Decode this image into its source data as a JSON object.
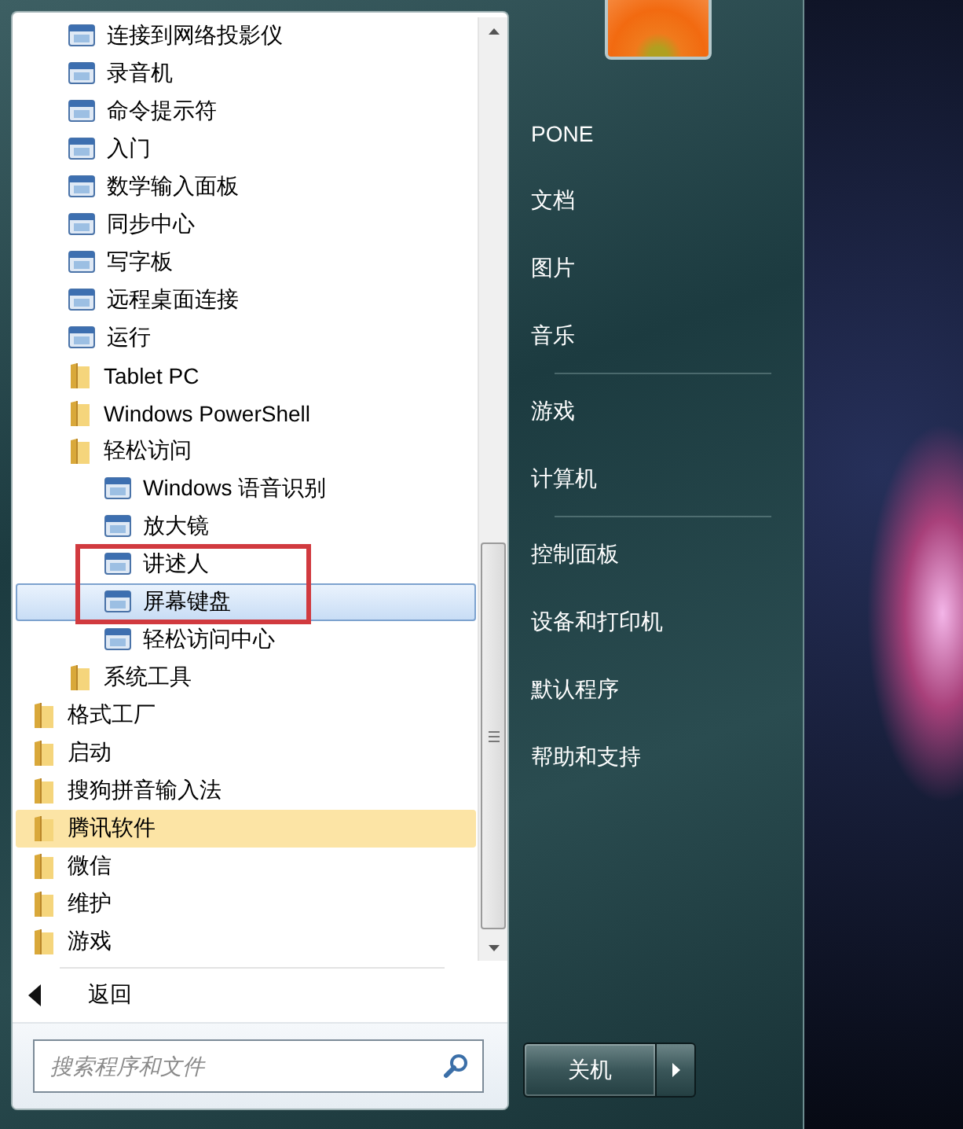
{
  "programs": [
    {
      "kind": "group",
      "children": [
        {
          "kind": "program",
          "label": "连接到网络投影仪",
          "selected": false,
          "new": false,
          "marked": false
        },
        {
          "kind": "program",
          "label": "录音机",
          "selected": false,
          "new": false,
          "marked": false
        },
        {
          "kind": "program",
          "label": "命令提示符",
          "selected": false,
          "new": false,
          "marked": false
        },
        {
          "kind": "program",
          "label": "入门",
          "selected": false,
          "new": false,
          "marked": false
        },
        {
          "kind": "program",
          "label": "数学输入面板",
          "selected": false,
          "new": false,
          "marked": false
        },
        {
          "kind": "program",
          "label": "同步中心",
          "selected": false,
          "new": false,
          "marked": false
        },
        {
          "kind": "program",
          "label": "写字板",
          "selected": false,
          "new": false,
          "marked": false
        },
        {
          "kind": "program",
          "label": "远程桌面连接",
          "selected": false,
          "new": false,
          "marked": false
        },
        {
          "kind": "program",
          "label": "运行",
          "selected": false,
          "new": false,
          "marked": false
        },
        {
          "kind": "folder",
          "label": "Tablet PC",
          "selected": false,
          "new": false,
          "marked": false
        },
        {
          "kind": "folder",
          "label": "Windows PowerShell",
          "selected": false,
          "new": false,
          "marked": false
        },
        {
          "kind": "folder",
          "label": "轻松访问",
          "selected": false,
          "new": false,
          "marked": false,
          "children": [
            {
              "kind": "program",
              "label": "Windows 语音识别",
              "selected": false,
              "new": false,
              "marked": false
            },
            {
              "kind": "program",
              "label": "放大镜",
              "selected": false,
              "new": false,
              "marked": false
            },
            {
              "kind": "program",
              "label": "讲述人",
              "selected": false,
              "new": false,
              "marked": true
            },
            {
              "kind": "program",
              "label": "屏幕键盘",
              "selected": true,
              "new": false,
              "marked": true
            },
            {
              "kind": "program",
              "label": "轻松访问中心",
              "selected": false,
              "new": false,
              "marked": false
            }
          ]
        },
        {
          "kind": "folder",
          "label": "系统工具",
          "selected": false,
          "new": false,
          "marked": false
        }
      ]
    },
    {
      "kind": "folder",
      "label": "格式工厂",
      "selected": false,
      "new": false,
      "marked": false
    },
    {
      "kind": "folder",
      "label": "启动",
      "selected": false,
      "new": false,
      "marked": false
    },
    {
      "kind": "folder",
      "label": "搜狗拼音输入法",
      "selected": false,
      "new": false,
      "marked": false
    },
    {
      "kind": "folder",
      "label": "腾讯软件",
      "selected": false,
      "new": true,
      "marked": false
    },
    {
      "kind": "folder",
      "label": "微信",
      "selected": false,
      "new": false,
      "marked": false
    },
    {
      "kind": "folder",
      "label": "维护",
      "selected": false,
      "new": false,
      "marked": false
    },
    {
      "kind": "folder",
      "label": "游戏",
      "selected": false,
      "new": false,
      "marked": false
    }
  ],
  "back": {
    "label": "返回"
  },
  "search": {
    "placeholder": "搜索程序和文件"
  },
  "places": [
    {
      "items": [
        "PONE",
        "文档",
        "图片",
        "音乐"
      ]
    },
    {
      "items": [
        "游戏",
        "计算机"
      ]
    },
    {
      "items": [
        "控制面板",
        "设备和打印机",
        "默认程序",
        "帮助和支持"
      ]
    }
  ],
  "shutdown": {
    "label": "关机"
  }
}
